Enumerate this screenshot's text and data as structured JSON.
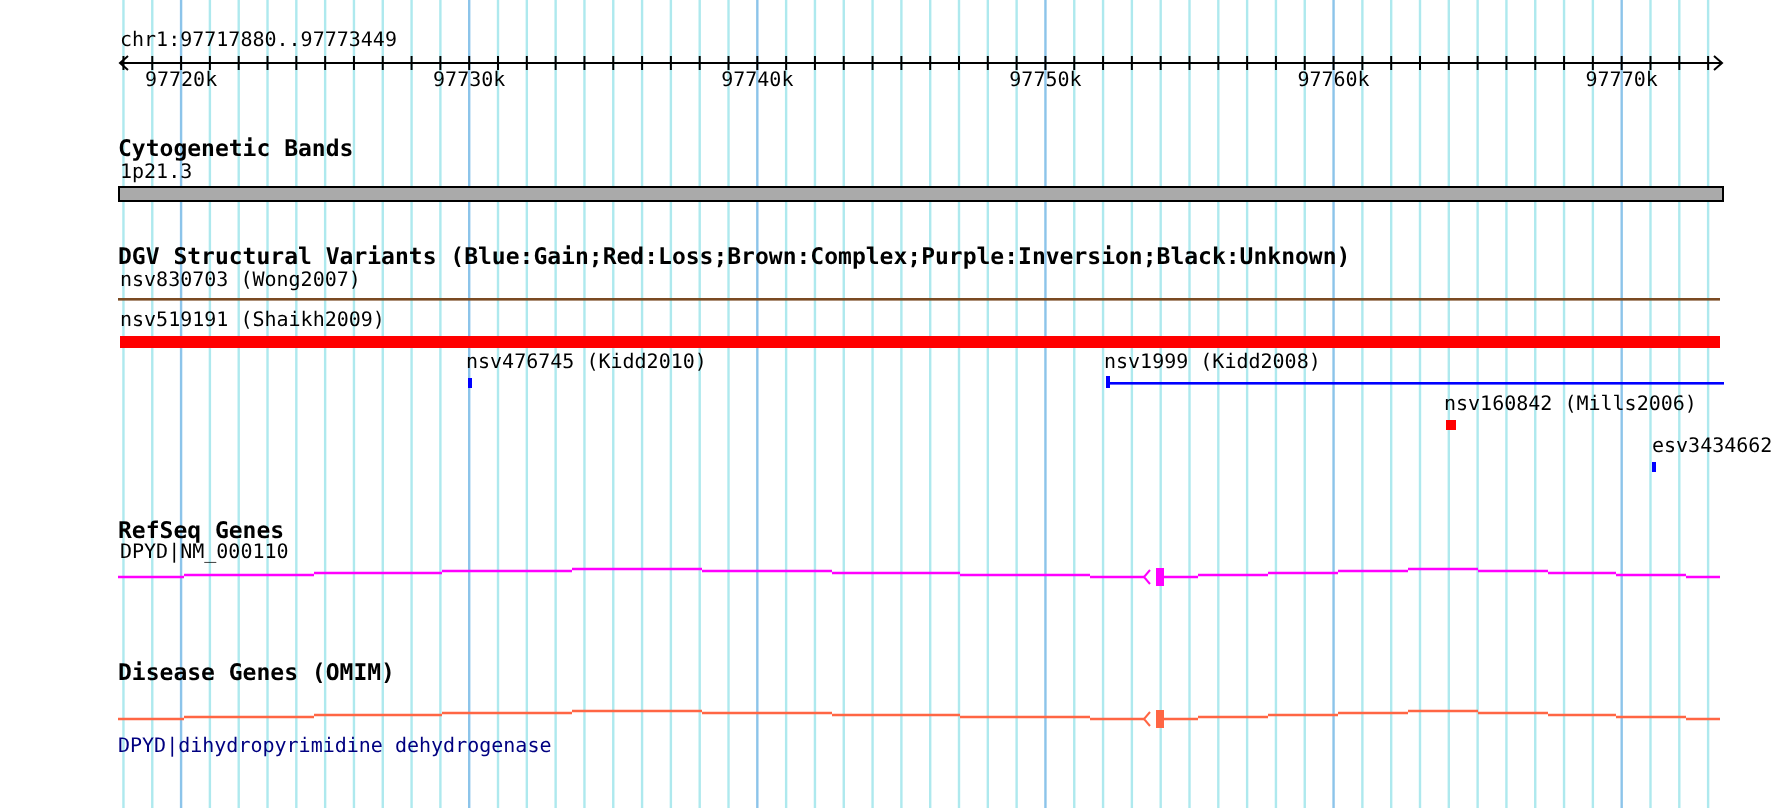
{
  "ruler": {
    "title": "chr1:97717880..97773449",
    "ticks": [
      "97720k",
      "97730k",
      "97740k",
      "97750k",
      "97760k",
      "97770k"
    ]
  },
  "tracks": [
    {
      "kind": "bands",
      "title": "Cytogenetic Bands",
      "features": [
        {
          "label": "1p21.3",
          "color": "#aaaaaa"
        }
      ]
    },
    {
      "kind": "variants",
      "title": "DGV Structural Variants (Blue:Gain;Red:Loss;Brown:Complex;Purple:Inversion;Black:Unknown)",
      "features": [
        {
          "label": "nsv830703 (Wong2007)",
          "color": "#7a4a22"
        },
        {
          "label": "nsv519191 (Shaikh2009)",
          "color": "#ff0000"
        },
        {
          "label": "nsv476745 (Kidd2010)",
          "color": "#0000ff"
        },
        {
          "label": "nsv1999 (Kidd2008)",
          "color": "#0000ff"
        },
        {
          "label": "nsv160842 (Mills2006)",
          "color": "#ff0000"
        },
        {
          "label": "esv3434662",
          "color": "#0000ff"
        }
      ]
    },
    {
      "kind": "gene",
      "title": "RefSeq Genes",
      "features": [
        {
          "label": "DPYD|NM_000110",
          "color": "#ff00ff"
        }
      ]
    },
    {
      "kind": "disease",
      "title": "Disease Genes (OMIM)",
      "features": [
        {
          "label": "DPYD|dihydropyrimidine dehydrogenase",
          "color": "#ff6644"
        }
      ]
    }
  ]
}
